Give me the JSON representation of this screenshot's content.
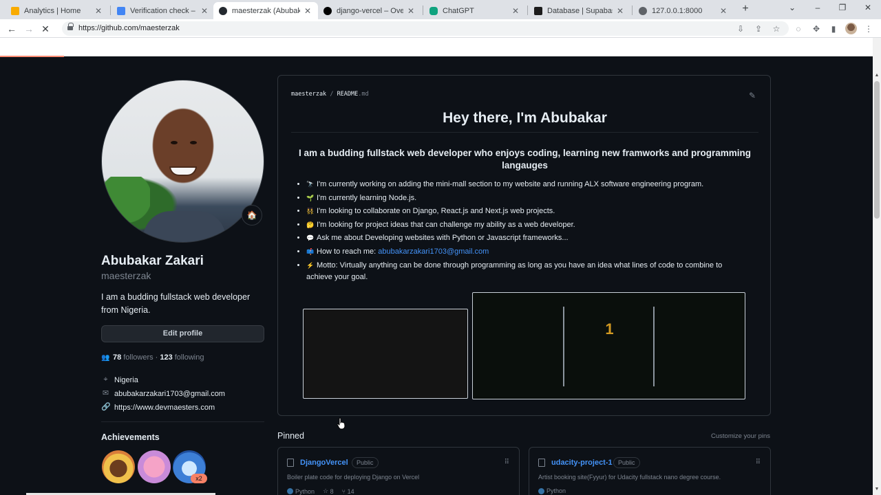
{
  "browser": {
    "tabs": [
      {
        "title": "Analytics | Home",
        "fav": "#f9ab00"
      },
      {
        "title": "Verification check – Pay",
        "fav": "#4285f4"
      },
      {
        "title": "maesterzak (Abubakar",
        "fav": "#24292f"
      },
      {
        "title": "django-vercel – Overvie",
        "fav": "#000000"
      },
      {
        "title": "ChatGPT",
        "fav": "#10a37f"
      },
      {
        "title": "Database | Supabase",
        "fav": "#1c1c1c"
      },
      {
        "title": "127.0.0.1:8000",
        "fav": "#5f6368"
      }
    ],
    "active_tab": 2,
    "url": "https://github.com/maesterzak"
  },
  "profile": {
    "status_emoji": "🏠",
    "fullname": "Abubakar Zakari",
    "login": "maesterzak",
    "bio": "I am a budding fullstack web developer from Nigeria.",
    "edit_button": "Edit profile",
    "followers_count": "78",
    "followers_label": "followers",
    "following_count": "123",
    "following_label": "following",
    "location": "Nigeria",
    "email": "abubakarzakari1703@gmail.com",
    "website": "https://www.devmaesters.com",
    "achievements_title": "Achievements",
    "badge_multiplier": "x2"
  },
  "readme": {
    "owner": "maesterzak",
    "separator": "/",
    "file": "README",
    "ext": ".md",
    "heading": "Hey there, I'm Abubakar",
    "subheading": "I am a budding fullstack web developer who enjoys coding, learning new framworks and programming langauges",
    "items": [
      {
        "emoji": "🔭",
        "text": "I'm currently working on adding the mini-mall section to my website and running ALX software engineering program."
      },
      {
        "emoji": "🌱",
        "text": "I'm currently learning Node.js."
      },
      {
        "emoji": "👯",
        "text": "I'm looking to collaborate on Django, React.js and Next.js web projects."
      },
      {
        "emoji": "🤔",
        "text": "I'm looking for project ideas that can challenge my ability as a web developer."
      },
      {
        "emoji": "💬",
        "text": "Ask me about Developing websites with Python or Javascript frameworks..."
      },
      {
        "emoji": "📫",
        "text": "How to reach me: ",
        "link": "abubakarzakari1703@gmail.com"
      },
      {
        "emoji": "⚡",
        "text": "Motto: Virtually anything can be done through programming as long as you have an idea what lines of code to combine to achieve your goal."
      }
    ],
    "pong_score": "1"
  },
  "pinned": {
    "title": "Pinned",
    "customize": "Customize your pins",
    "repos": [
      {
        "name": "DjangoVercel",
        "visibility": "Public",
        "description": "Boiler plate code for deploying Django on Vercel",
        "language": "Python",
        "stars": "8",
        "forks": "14"
      },
      {
        "name": "udacity-project-1",
        "visibility": "Public",
        "description": "Artist booking site(Fyyur) for Udacity fullstack nano degree course.",
        "language": "Python"
      }
    ]
  }
}
